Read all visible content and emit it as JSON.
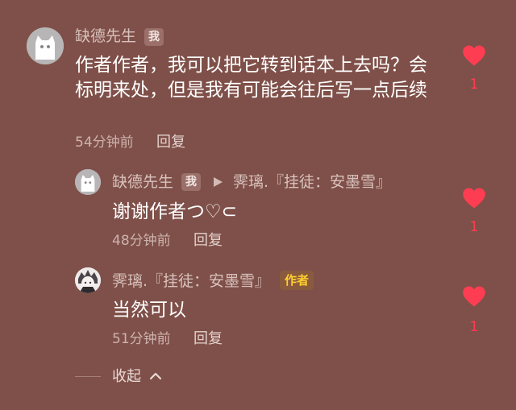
{
  "comment": {
    "username": "缺德先生",
    "me_badge": "我",
    "text": "作者作者，我可以把它转到话本上去吗？会标明来处，但是我有可能会往后写一点后续",
    "time": "54分钟前",
    "reply_label": "回复",
    "like_count": "1",
    "avatar_icon": "cat-avatar-icon",
    "like_icon": "heart-icon"
  },
  "replies": [
    {
      "username": "缺德先生",
      "me_badge": "我",
      "reply_to": "霁璃.『挂徒：安墨雪』",
      "text": "谢谢作者つ♡⊂",
      "time": "48分钟前",
      "reply_label": "回复",
      "like_count": "1",
      "avatar_icon": "cat-avatar-icon",
      "like_icon": "heart-icon"
    },
    {
      "username": "霁璃.『挂徒：安墨雪』",
      "author_badge": "作者",
      "text": "当然可以",
      "time": "51分钟前",
      "reply_label": "回复",
      "like_count": "1",
      "avatar_icon": "anime-avatar-icon",
      "like_icon": "heart-icon"
    }
  ],
  "collapse_label": "收起",
  "colors": {
    "background": "#7f5049",
    "like": "#ff3d52",
    "author_badge_text": "#ffcf2e"
  }
}
